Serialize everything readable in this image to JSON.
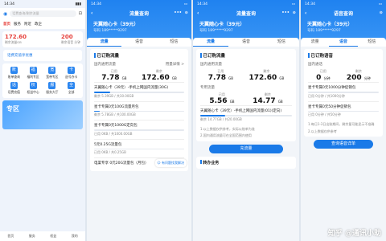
{
  "s1": {
    "time": "14:34",
    "search_placeholder": "话费查询/剩余流量",
    "tabs": [
      "首页",
      "服务",
      "附近",
      "政企"
    ],
    "balance": [
      {
        "v": "172.60",
        "c": "剩余流量GB"
      },
      {
        "v": "200",
        "c": "剩余语音 分钟"
      }
    ],
    "promo": "话费充值享优惠",
    "grid": [
      {
        "i": "账",
        "t": "账单查询"
      },
      {
        "i": "福",
        "t": "福利专区"
      },
      {
        "i": "宽",
        "t": "宽带专区"
      },
      {
        "i": "卡",
        "t": "选号办卡"
      },
      {
        "i": "话",
        "t": "话费充值"
      },
      {
        "i": "权",
        "t": "权益中心"
      },
      {
        "i": "服",
        "t": "服务大厅"
      },
      {
        "i": "全",
        "t": "全部"
      }
    ],
    "banner": "专区",
    "nav": [
      "首页",
      "服务",
      "权益",
      "我的"
    ]
  },
  "s2": {
    "time": "14:34",
    "title": "流量查询",
    "plan": "天翼随心卡（39元）",
    "number": "号码 189*****9297",
    "tabs": [
      "流量",
      "语音",
      "短信"
    ],
    "section": "已订购流量",
    "domestic_label": "国内通用流量",
    "detail_link": "用量详情 >",
    "stats": [
      {
        "cap": "已用",
        "v": "7.78",
        "u": "GB"
      },
      {
        "cap": "剩余",
        "v": "172.60",
        "u": "GB"
      }
    ],
    "items": [
      {
        "t": "天翼随心卡（39元）-手机上网国内流量(30G)",
        "sub": "剩余 5.39GB / 共30.00GB",
        "p": 0.18
      },
      {
        "t": "星卡专属0元100G流量月包",
        "sub": "剩余 5.78GB / 共100.00GB",
        "p": 0.06
      },
      {
        "t": "星卡专属0元1000G定向包",
        "sub": "已用 0KB / 共1000.00GB",
        "p": 0.0
      },
      {
        "t": "5元0.25G流量包",
        "sub": "已用 0KB / 共0.25GB",
        "p": 0.0
      }
    ],
    "recent": "电渠专享 0元20G流量包（月包）",
    "popup": "有问题找我解决"
  },
  "s3": {
    "time": "14:34",
    "title": "流量查询",
    "plan": "天翼随心卡（39元）",
    "number": "号码 189*****9297",
    "tabs": [
      "流量",
      "语音",
      "短信"
    ],
    "section": "已订购流量",
    "domestic_label": "国内通用流量",
    "stats": [
      {
        "cap": "已用",
        "v": "7.78",
        "u": "GB"
      },
      {
        "cap": "剩余",
        "v": "172.60",
        "u": "GB"
      }
    ],
    "special_label": "专用流量",
    "special_stats": [
      {
        "cap": "已用",
        "v": "5.56",
        "u": "GB"
      },
      {
        "cap": "剩余",
        "v": "14.77",
        "u": "GB"
      }
    ],
    "items": [
      {
        "t": "天翼随心卡（39元）-手机上网国内流量(01)(定向)",
        "sub": "剩余 14.77GB / 共20.00GB",
        "p": 0.27
      }
    ],
    "notes": [
      "1.以上数据仅供参考，实际以账单为准",
      "2.国内通用流量可在全国范围内使用"
    ],
    "button": "充流量",
    "footer": "转办业务"
  },
  "s4": {
    "time": "14:34",
    "title": "语音查询",
    "plan": "天翼随心卡（39元）",
    "number": "号码 189*****9297",
    "tabs": [
      "流量",
      "语音",
      "短信"
    ],
    "section": "已订购语音",
    "domestic_label": "国内通话",
    "stats": [
      {
        "cap": "已用",
        "v": "0",
        "u": "分钟"
      },
      {
        "cap": "剩余",
        "v": "200",
        "u": "分钟"
      }
    ],
    "items": [
      {
        "t": "星卡专属0元1000分钟促销包",
        "sub": "已用 0分钟 / 共1000分钟",
        "p": 0.0
      },
      {
        "t": "星卡专属0元50分钟促销包",
        "sub": "已用 0分钟 / 共50分钟",
        "p": 0.0
      }
    ],
    "notes": [
      "1.每日1-3日出账期间，剩余量可能显示不准确",
      "2.以上数据仅供参考"
    ],
    "button": "查询语音详单",
    "watermark": "知乎 @通讯小助"
  }
}
